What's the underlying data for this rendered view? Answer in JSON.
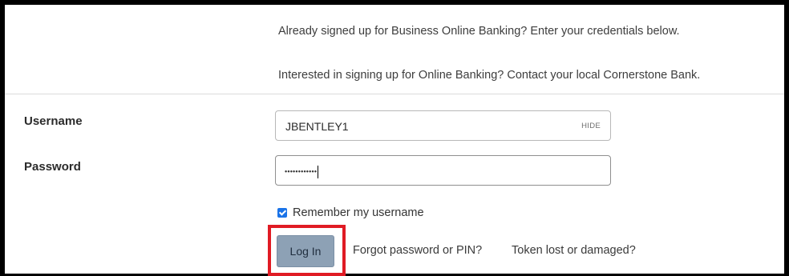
{
  "intro": {
    "line1": "Already signed up for Business Online Banking? Enter your credentials below.",
    "line2": "Interested in signing up for Online Banking? Contact your local Cornerstone Bank."
  },
  "form": {
    "username_label": "Username",
    "username_value": "JBENTLEY1",
    "hide_label": "HIDE",
    "password_label": "Password",
    "password_masked": "••••••••••••",
    "remember_label": "Remember my username",
    "remember_checked": true,
    "login_label": "Log In",
    "forgot_link": "Forgot password or PIN?",
    "token_link": "Token lost or damaged?"
  },
  "colors": {
    "highlight": "#e01b24",
    "button": "#8da1b5",
    "checkbox": "#1a73e8"
  }
}
